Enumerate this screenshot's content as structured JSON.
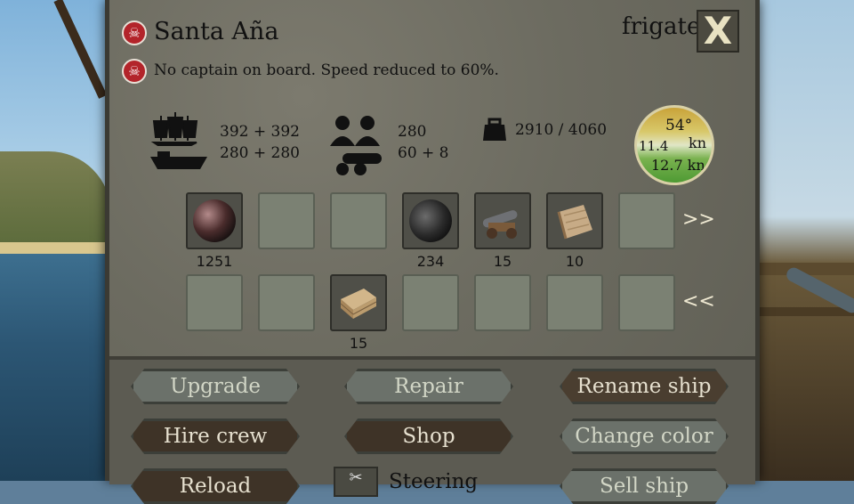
{
  "ship": {
    "name": "Santa Aña",
    "type": "frigate",
    "notice": "No captain on board. Speed reduced to 60%.",
    "close_label": "X"
  },
  "stats": {
    "sails": "392 + 392",
    "hull": "280 + 280",
    "crew": "280",
    "cannons": "60 + 8",
    "cargo": "2910 / 4060"
  },
  "compass": {
    "angle": "54°",
    "left_speed": "11.4",
    "unit": "kn",
    "speed": "12.7 kn"
  },
  "inventory": {
    "row1": [
      {
        "icon": "cannonball-icon",
        "qty": "1251"
      },
      {
        "icon": null,
        "qty": ""
      },
      {
        "icon": null,
        "qty": ""
      },
      {
        "icon": "bomb-icon",
        "qty": "234"
      },
      {
        "icon": "cannon-icon",
        "qty": "15"
      },
      {
        "icon": "cloth-roll-icon",
        "qty": "10"
      },
      {
        "icon": null,
        "qty": ""
      }
    ],
    "row2": [
      {
        "icon": null,
        "qty": ""
      },
      {
        "icon": null,
        "qty": ""
      },
      {
        "icon": "planks-icon",
        "qty": "15"
      },
      {
        "icon": null,
        "qty": ""
      },
      {
        "icon": null,
        "qty": ""
      },
      {
        "icon": null,
        "qty": ""
      },
      {
        "icon": null,
        "qty": ""
      }
    ],
    "next_label": ">>",
    "prev_label": "<<"
  },
  "buttons": {
    "upgrade": "Upgrade",
    "repair": "Repair",
    "rename": "Rename ship",
    "hire": "Hire crew",
    "shop": "Shop",
    "color": "Change color",
    "reload": "Reload",
    "steering": "Steering ",
    "sell": "Sell ship"
  }
}
